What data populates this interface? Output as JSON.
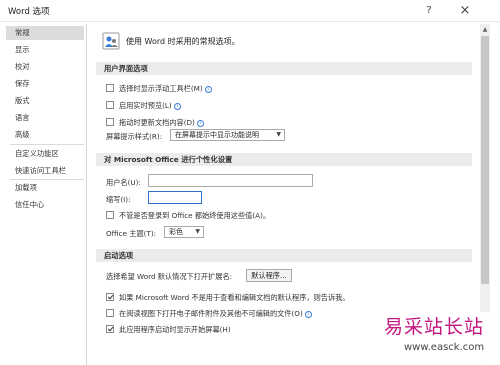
{
  "window": {
    "title": "Word 选项",
    "help": "?",
    "close": "×"
  },
  "sidebar": {
    "items": [
      {
        "label": "常规"
      },
      {
        "label": "显示"
      },
      {
        "label": "校对"
      },
      {
        "label": "保存"
      },
      {
        "label": "版式"
      },
      {
        "label": "语言"
      },
      {
        "label": "高级"
      },
      {
        "label": "自定义功能区"
      },
      {
        "label": "快速访问工具栏"
      },
      {
        "label": "加载项"
      },
      {
        "label": "信任中心"
      }
    ]
  },
  "header": {
    "text": "使用 Word 时采用的常规选项。"
  },
  "ui_section": {
    "title": "用户界面选项",
    "options": [
      {
        "label": "选择时显示浮动工具栏(M)",
        "checked": false
      },
      {
        "label": "启用实时预览(L)",
        "checked": false
      },
      {
        "label": "拖动时更新文档内容(D)",
        "checked": false
      }
    ],
    "tooltip_label": "屏幕提示样式(R):",
    "tooltip_value": "在屏幕提示中显示功能说明"
  },
  "personalize_section": {
    "title": "对 Microsoft Office 进行个性化设置",
    "username_label": "用户名(U):",
    "username_value": "",
    "initials_label": "缩写(I):",
    "initials_value": "",
    "always_use_label": "不管是否登录到 Office 都始终使用这些值(A)。",
    "always_use_checked": false,
    "theme_label": "Office 主题(T):",
    "theme_value": "彩色"
  },
  "startup_section": {
    "title": "启动选项",
    "ext_label": "选择希望 Word 默认情况下打开扩展名:",
    "default_programs_btn": "默认程序...",
    "options": [
      {
        "label": "如果 Microsoft Word 不是用于查看和编辑文档的默认程序，则告诉我。",
        "checked": true
      },
      {
        "label": "在阅读视图下打开电子邮件附件及其他不可编辑的文件(O)",
        "checked": false
      },
      {
        "label": "此应用程序启动时显示开始屏幕(H)",
        "checked": true
      }
    ]
  },
  "watermark": {
    "title": "易采站长站",
    "url": "www.easck.com"
  },
  "colors": {
    "accent": "#2b6fc9",
    "watermark": "#c3177f",
    "section_bg": "#ececec"
  }
}
